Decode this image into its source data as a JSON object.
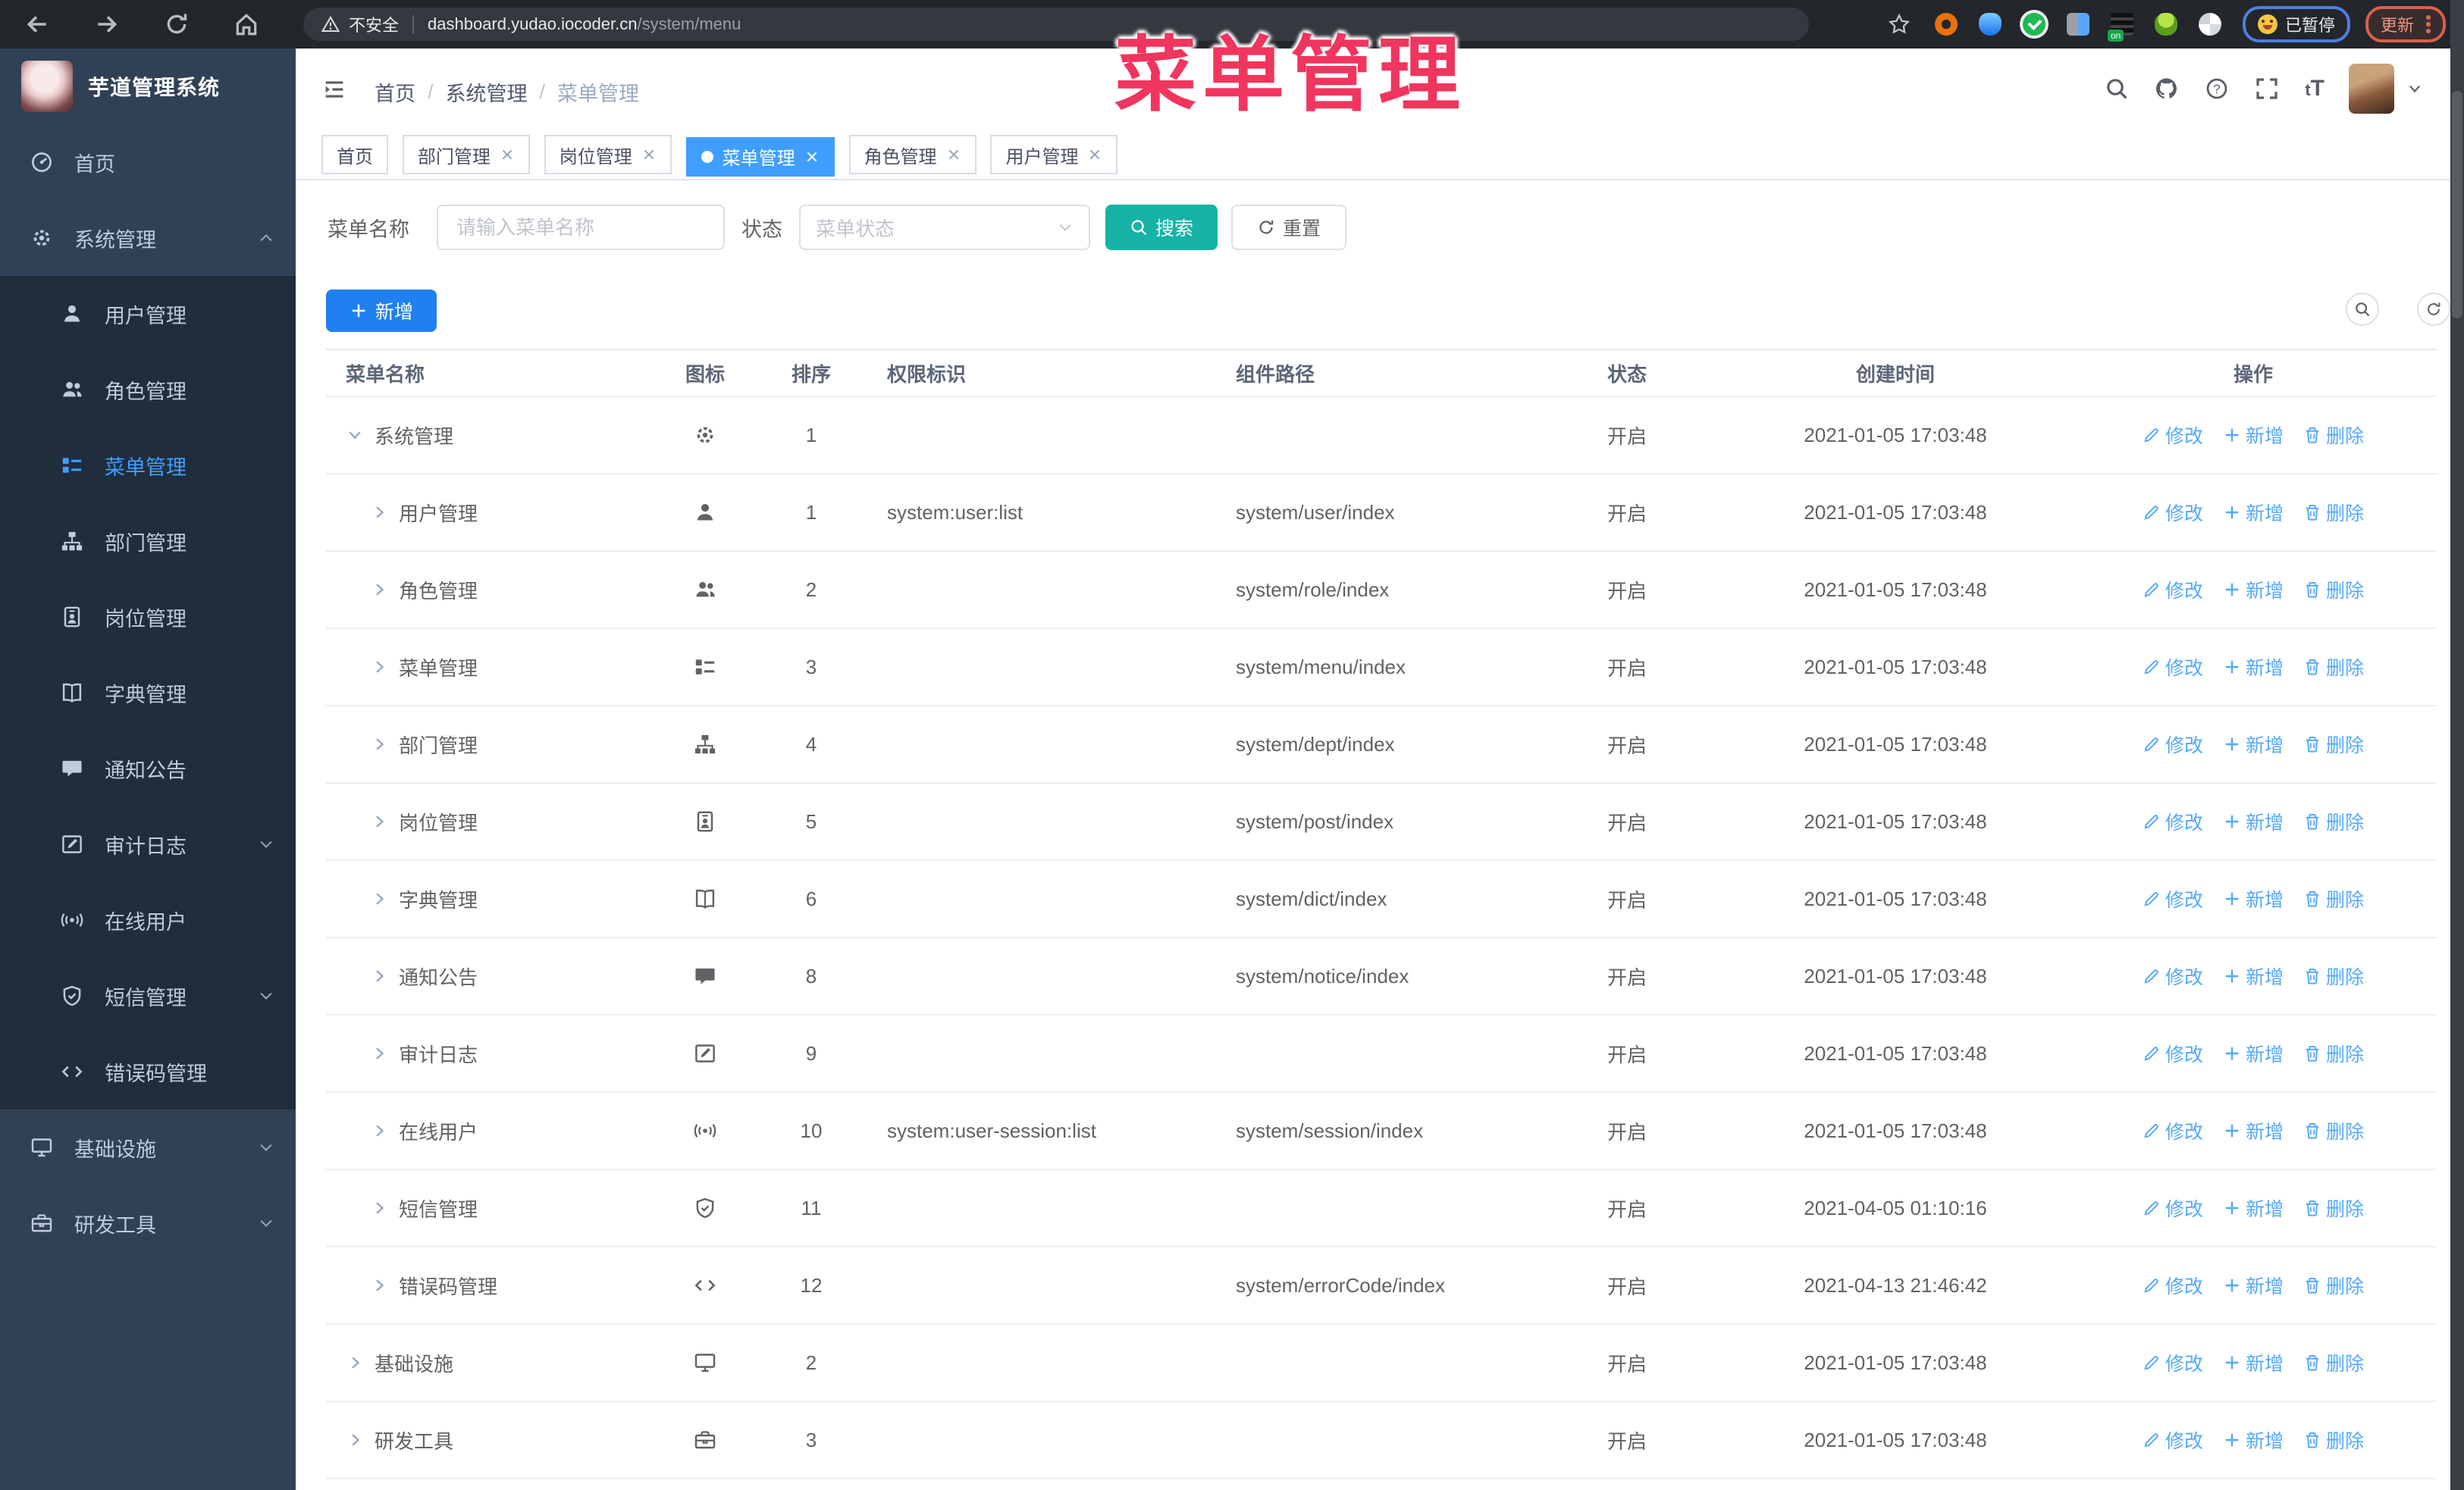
{
  "browser": {
    "security_label": "不安全",
    "url_host": "dashboard.yudao.iocoder.cn",
    "url_path": "/system/menu",
    "paused_label": "已暂停",
    "update_label": "更新",
    "on_badge": "on",
    "nav_icons": [
      "back-icon",
      "forward-icon",
      "reload-icon",
      "home-icon"
    ],
    "extension_icons": [
      "bookmark-star-icon",
      "orange-ring-extension-icon",
      "blue-drop-extension-icon",
      "green-check-extension-icon",
      "grid-extension-icon",
      "server-on-extension-icon",
      "green-person-extension-icon",
      "pinwheel-extension-icon"
    ]
  },
  "watermark": {
    "text": "菜单管理"
  },
  "sidebar": {
    "title": "芋道管理系统",
    "items": [
      {
        "label": "首页",
        "icon": "dashboard-icon",
        "chevron": "",
        "child": false,
        "active": false
      },
      {
        "label": "系统管理",
        "icon": "gear-icon",
        "chevron": "chevron-up-icon",
        "child": false,
        "active": false
      },
      {
        "label": "用户管理",
        "icon": "user-icon",
        "chevron": "",
        "child": true,
        "active": false
      },
      {
        "label": "角色管理",
        "icon": "users-icon",
        "chevron": "",
        "child": true,
        "active": false
      },
      {
        "label": "菜单管理",
        "icon": "menu-list-icon",
        "chevron": "",
        "child": true,
        "active": true
      },
      {
        "label": "部门管理",
        "icon": "org-tree-icon",
        "chevron": "",
        "child": true,
        "active": false
      },
      {
        "label": "岗位管理",
        "icon": "badge-icon",
        "chevron": "",
        "child": true,
        "active": false
      },
      {
        "label": "字典管理",
        "icon": "book-icon",
        "chevron": "",
        "child": true,
        "active": false
      },
      {
        "label": "通知公告",
        "icon": "chat-icon",
        "chevron": "",
        "child": true,
        "active": false
      },
      {
        "label": "审计日志",
        "icon": "edit-note-icon",
        "chevron": "chevron-down-icon",
        "child": true,
        "active": false
      },
      {
        "label": "在线用户",
        "icon": "online-icon",
        "chevron": "",
        "child": true,
        "active": false
      },
      {
        "label": "短信管理",
        "icon": "shield-icon",
        "chevron": "chevron-down-icon",
        "child": true,
        "active": false
      },
      {
        "label": "错误码管理",
        "icon": "code-icon",
        "chevron": "",
        "child": true,
        "active": false
      },
      {
        "label": "基础设施",
        "icon": "monitor-icon",
        "chevron": "chevron-down-icon",
        "child": false,
        "active": false
      },
      {
        "label": "研发工具",
        "icon": "toolbox-icon",
        "chevron": "chevron-down-icon",
        "child": false,
        "active": false
      }
    ]
  },
  "header": {
    "breadcrumb": [
      "首页",
      "系统管理",
      "菜单管理"
    ],
    "breadcrumb_sep": "/",
    "right_icons": [
      "search-icon",
      "github-icon",
      "help-icon",
      "fullscreen-icon"
    ],
    "font_size_label": "tT"
  },
  "tags": [
    {
      "label": "首页",
      "closable": false,
      "active": false
    },
    {
      "label": "部门管理",
      "closable": true,
      "active": false
    },
    {
      "label": "岗位管理",
      "closable": true,
      "active": false
    },
    {
      "label": "菜单管理",
      "closable": true,
      "active": true
    },
    {
      "label": "角色管理",
      "closable": true,
      "active": false
    },
    {
      "label": "用户管理",
      "closable": true,
      "active": false
    }
  ],
  "filters": {
    "name_label": "菜单名称",
    "name_placeholder": "请输入菜单名称",
    "status_label": "状态",
    "status_placeholder": "菜单状态",
    "search_label": "搜索",
    "reset_label": "重置"
  },
  "toolbar": {
    "add_label": "新增"
  },
  "table": {
    "columns": [
      "菜单名称",
      "图标",
      "排序",
      "权限标识",
      "组件路径",
      "状态",
      "创建时间",
      "操作"
    ],
    "action_modify": "修改",
    "action_add": "新增",
    "action_delete": "删除",
    "rows": [
      {
        "name": "系统管理",
        "icon": "gear-icon",
        "sort": "1",
        "perm": "",
        "path": "",
        "status": "开启",
        "time": "2021-01-05 17:03:48",
        "caret": "caret-down-icon",
        "child": false
      },
      {
        "name": "用户管理",
        "icon": "user-icon",
        "sort": "1",
        "perm": "system:user:list",
        "path": "system/user/index",
        "status": "开启",
        "time": "2021-01-05 17:03:48",
        "caret": "caret-right-icon",
        "child": true
      },
      {
        "name": "角色管理",
        "icon": "users-icon",
        "sort": "2",
        "perm": "",
        "path": "system/role/index",
        "status": "开启",
        "time": "2021-01-05 17:03:48",
        "caret": "caret-right-icon",
        "child": true
      },
      {
        "name": "菜单管理",
        "icon": "menu-list-icon",
        "sort": "3",
        "perm": "",
        "path": "system/menu/index",
        "status": "开启",
        "time": "2021-01-05 17:03:48",
        "caret": "caret-right-icon",
        "child": true
      },
      {
        "name": "部门管理",
        "icon": "org-tree-icon",
        "sort": "4",
        "perm": "",
        "path": "system/dept/index",
        "status": "开启",
        "time": "2021-01-05 17:03:48",
        "caret": "caret-right-icon",
        "child": true
      },
      {
        "name": "岗位管理",
        "icon": "badge-icon",
        "sort": "5",
        "perm": "",
        "path": "system/post/index",
        "status": "开启",
        "time": "2021-01-05 17:03:48",
        "caret": "caret-right-icon",
        "child": true
      },
      {
        "name": "字典管理",
        "icon": "book-icon",
        "sort": "6",
        "perm": "",
        "path": "system/dict/index",
        "status": "开启",
        "time": "2021-01-05 17:03:48",
        "caret": "caret-right-icon",
        "child": true
      },
      {
        "name": "通知公告",
        "icon": "chat-icon",
        "sort": "8",
        "perm": "",
        "path": "system/notice/index",
        "status": "开启",
        "time": "2021-01-05 17:03:48",
        "caret": "caret-right-icon",
        "child": true
      },
      {
        "name": "审计日志",
        "icon": "edit-note-icon",
        "sort": "9",
        "perm": "",
        "path": "",
        "status": "开启",
        "time": "2021-01-05 17:03:48",
        "caret": "caret-right-icon",
        "child": true
      },
      {
        "name": "在线用户",
        "icon": "online-icon",
        "sort": "10",
        "perm": "system:user-session:list",
        "path": "system/session/index",
        "status": "开启",
        "time": "2021-01-05 17:03:48",
        "caret": "caret-right-icon",
        "child": true
      },
      {
        "name": "短信管理",
        "icon": "shield-icon",
        "sort": "11",
        "perm": "",
        "path": "",
        "status": "开启",
        "time": "2021-04-05 01:10:16",
        "caret": "caret-right-icon",
        "child": true
      },
      {
        "name": "错误码管理",
        "icon": "code-icon",
        "sort": "12",
        "perm": "",
        "path": "system/errorCode/index",
        "status": "开启",
        "time": "2021-04-13 21:46:42",
        "caret": "caret-right-icon",
        "child": true
      },
      {
        "name": "基础设施",
        "icon": "monitor-icon",
        "sort": "2",
        "perm": "",
        "path": "",
        "status": "开启",
        "time": "2021-01-05 17:03:48",
        "caret": "caret-right-icon",
        "child": false
      },
      {
        "name": "研发工具",
        "icon": "toolbox-icon",
        "sort": "3",
        "perm": "",
        "path": "",
        "status": "开启",
        "time": "2021-01-05 17:03:48",
        "caret": "caret-right-icon",
        "child": false
      }
    ]
  },
  "colors": {
    "accent_blue": "#409eff",
    "search_button": "#16b3a6",
    "add_button": "#2080f0",
    "table_link": "#54a8ff",
    "watermark_pink": "#f0355e",
    "sidebar_bg": "#304156",
    "submenu_bg": "#1f2d3d"
  }
}
